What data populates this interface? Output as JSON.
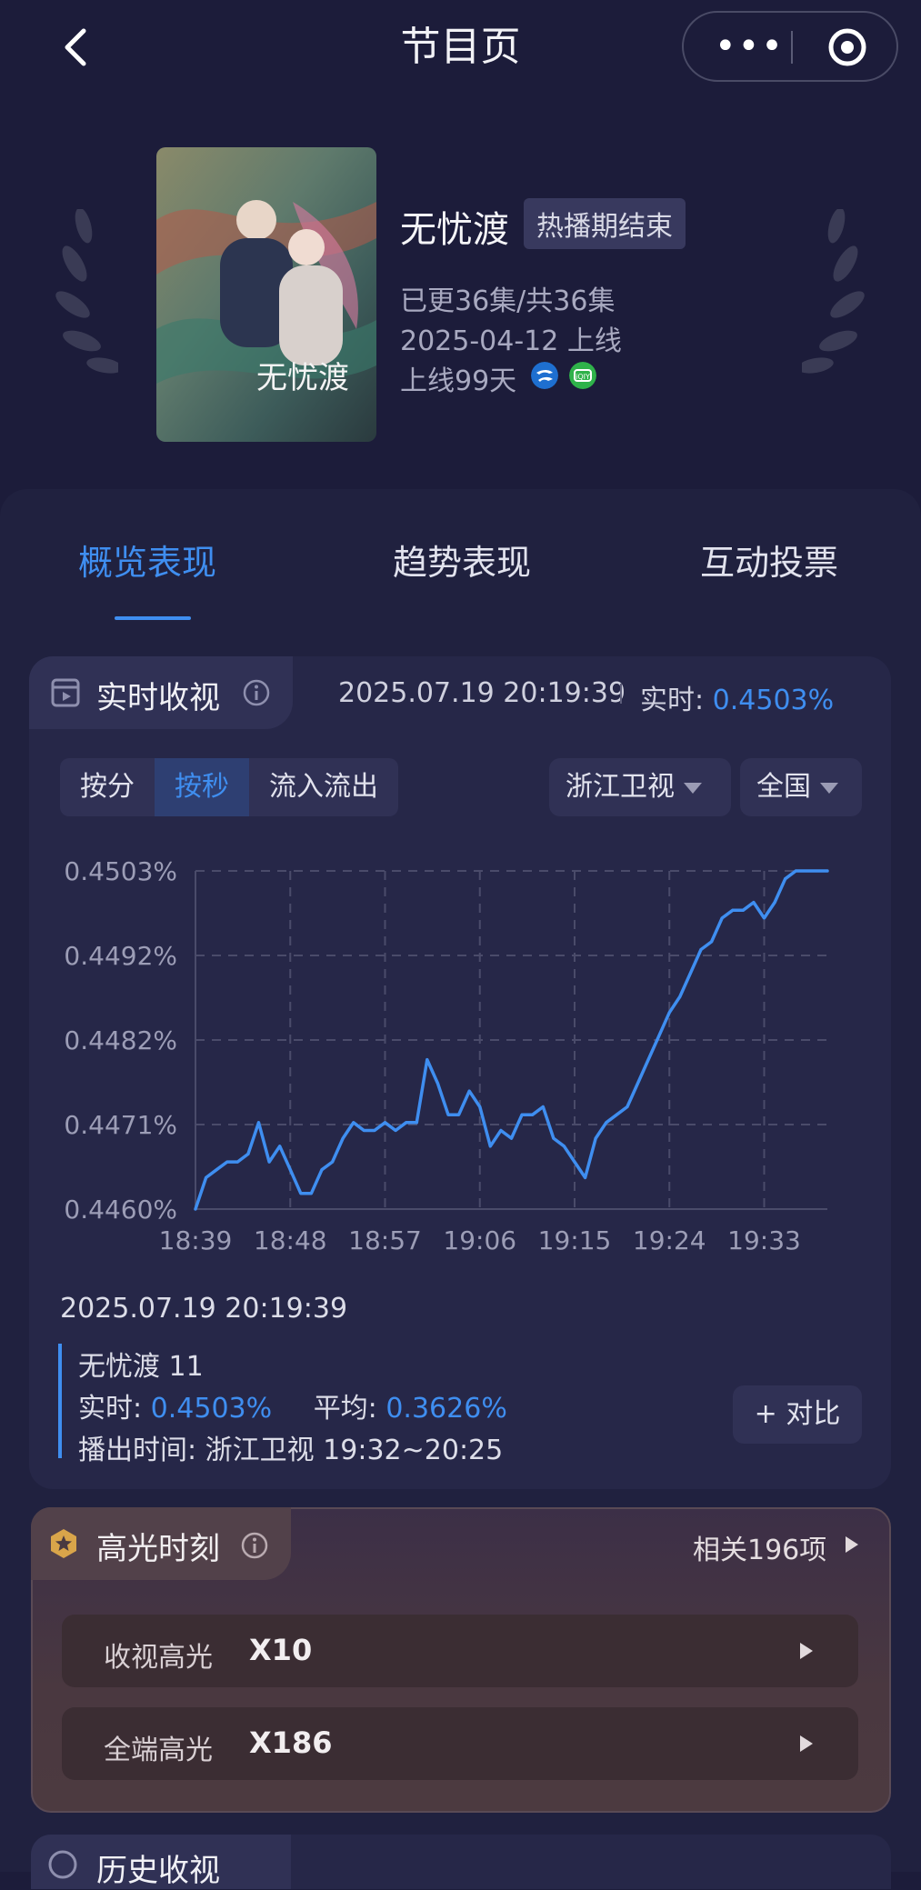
{
  "topbar": {
    "title": "节目页"
  },
  "show": {
    "title": "无忧渡",
    "status_badge": "热播期结束",
    "poster_title": "无忧渡",
    "episodes": "已更36集/共36集",
    "premiere": "2025-04-12 上线",
    "days_online": "上线99天",
    "channel_icons": [
      "zhejiang-tv-icon",
      "iqiyi-icon"
    ]
  },
  "tabs": [
    {
      "label": "概览表现",
      "active": true
    },
    {
      "label": "趋势表现",
      "active": false
    },
    {
      "label": "互动投票",
      "active": false
    }
  ],
  "realtime": {
    "title": "实时收视",
    "timestamp": "2025.07.19 20:19:39",
    "realtime_label": "实时:",
    "realtime_value": "0.4503%",
    "modes": [
      "按分",
      "按秒",
      "流入流出"
    ],
    "active_mode": "按秒",
    "channel_dropdown": "浙江卫视",
    "region_dropdown": "全国"
  },
  "chart_data": {
    "type": "line",
    "x": [
      "18:39",
      "18:40",
      "18:41",
      "18:42",
      "18:43",
      "18:44",
      "18:45",
      "18:46",
      "18:47",
      "18:48",
      "18:49",
      "18:50",
      "18:51",
      "18:52",
      "18:53",
      "18:54",
      "18:55",
      "18:56",
      "18:57",
      "18:58",
      "18:59",
      "19:00",
      "19:01",
      "19:02",
      "19:03",
      "19:04",
      "19:05",
      "19:06",
      "19:07",
      "19:08",
      "19:09",
      "19:10",
      "19:11",
      "19:12",
      "19:13",
      "19:14",
      "19:15",
      "19:16",
      "19:17",
      "19:18",
      "19:19",
      "19:20",
      "19:21",
      "19:22",
      "19:23",
      "19:24",
      "19:25",
      "19:26",
      "19:27",
      "19:28",
      "19:29",
      "19:30",
      "19:31",
      "19:32",
      "19:33",
      "19:34",
      "19:35",
      "19:36",
      "19:37",
      "19:38",
      "19:39"
    ],
    "values": [
      0.446,
      0.4464,
      0.4465,
      0.4466,
      0.4466,
      0.4467,
      0.4471,
      0.4466,
      0.4468,
      0.4465,
      0.4462,
      0.4462,
      0.4465,
      0.4466,
      0.4469,
      0.4471,
      0.447,
      0.447,
      0.4471,
      0.447,
      0.4471,
      0.4471,
      0.4479,
      0.4476,
      0.4472,
      0.4472,
      0.4475,
      0.4473,
      0.4468,
      0.447,
      0.4469,
      0.4472,
      0.4472,
      0.4473,
      0.4469,
      0.4468,
      0.4466,
      0.4464,
      0.4469,
      0.4471,
      0.4472,
      0.4473,
      0.4476,
      0.4479,
      0.4482,
      0.4485,
      0.4487,
      0.449,
      0.4493,
      0.4494,
      0.4497,
      0.4498,
      0.4498,
      0.4499,
      0.4497,
      0.4499,
      0.4502,
      0.4503,
      0.4503,
      0.4503,
      0.4503
    ],
    "xticks": [
      "18:39",
      "18:48",
      "18:57",
      "19:06",
      "19:15",
      "19:24",
      "19:33"
    ],
    "yticks": [
      "0.4503%",
      "0.4492%",
      "0.4482%",
      "0.4471%",
      "0.4460%"
    ],
    "ylim": [
      0.446,
      0.4503
    ],
    "grid": true,
    "line_color": "#3f8ef0"
  },
  "selection": {
    "timestamp": "2025.07.19 20:19:39",
    "episode": "无忧渡 11",
    "realtime_label": "实时:",
    "realtime_value": "0.4503%",
    "avg_label": "平均:",
    "avg_value": "0.3626%",
    "airtime": "播出时间:  浙江卫视 19:32~20:25",
    "compare_button": "+ 对比"
  },
  "highlights": {
    "title": "高光时刻",
    "related": "相关196项",
    "rows": [
      {
        "label": "收视高光",
        "value": "X10"
      },
      {
        "label": "全端高光",
        "value": "X186"
      }
    ]
  },
  "history": {
    "title": "历史收视"
  },
  "colors": {
    "accent": "#3f8ef0",
    "background": "#1c1c3a",
    "card": "#262748"
  }
}
